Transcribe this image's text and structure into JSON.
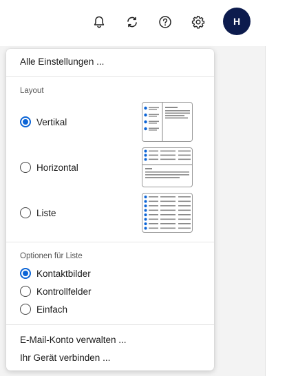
{
  "header": {
    "icons": [
      "bell-icon",
      "sync-icon",
      "help-icon",
      "gear-icon"
    ],
    "avatar_initial": "H",
    "avatar_color": "#0c1b4d"
  },
  "menu": {
    "all_settings": "Alle Einstellungen ...",
    "layout_label": "Layout",
    "layout_options": [
      {
        "label": "Vertikal",
        "checked": true
      },
      {
        "label": "Horizontal",
        "checked": false
      },
      {
        "label": "Liste",
        "checked": false
      }
    ],
    "list_options_label": "Optionen für Liste",
    "list_options": [
      {
        "label": "Kontaktbilder",
        "checked": true
      },
      {
        "label": "Kontrollfelder",
        "checked": false
      },
      {
        "label": "Einfach",
        "checked": false
      }
    ],
    "manage_account": "E-Mail-Konto verwalten ...",
    "connect_device": "Ihr Gerät verbinden ..."
  },
  "colors": {
    "accent": "#0b64d6",
    "thumb_line": "#8a8a8a"
  }
}
